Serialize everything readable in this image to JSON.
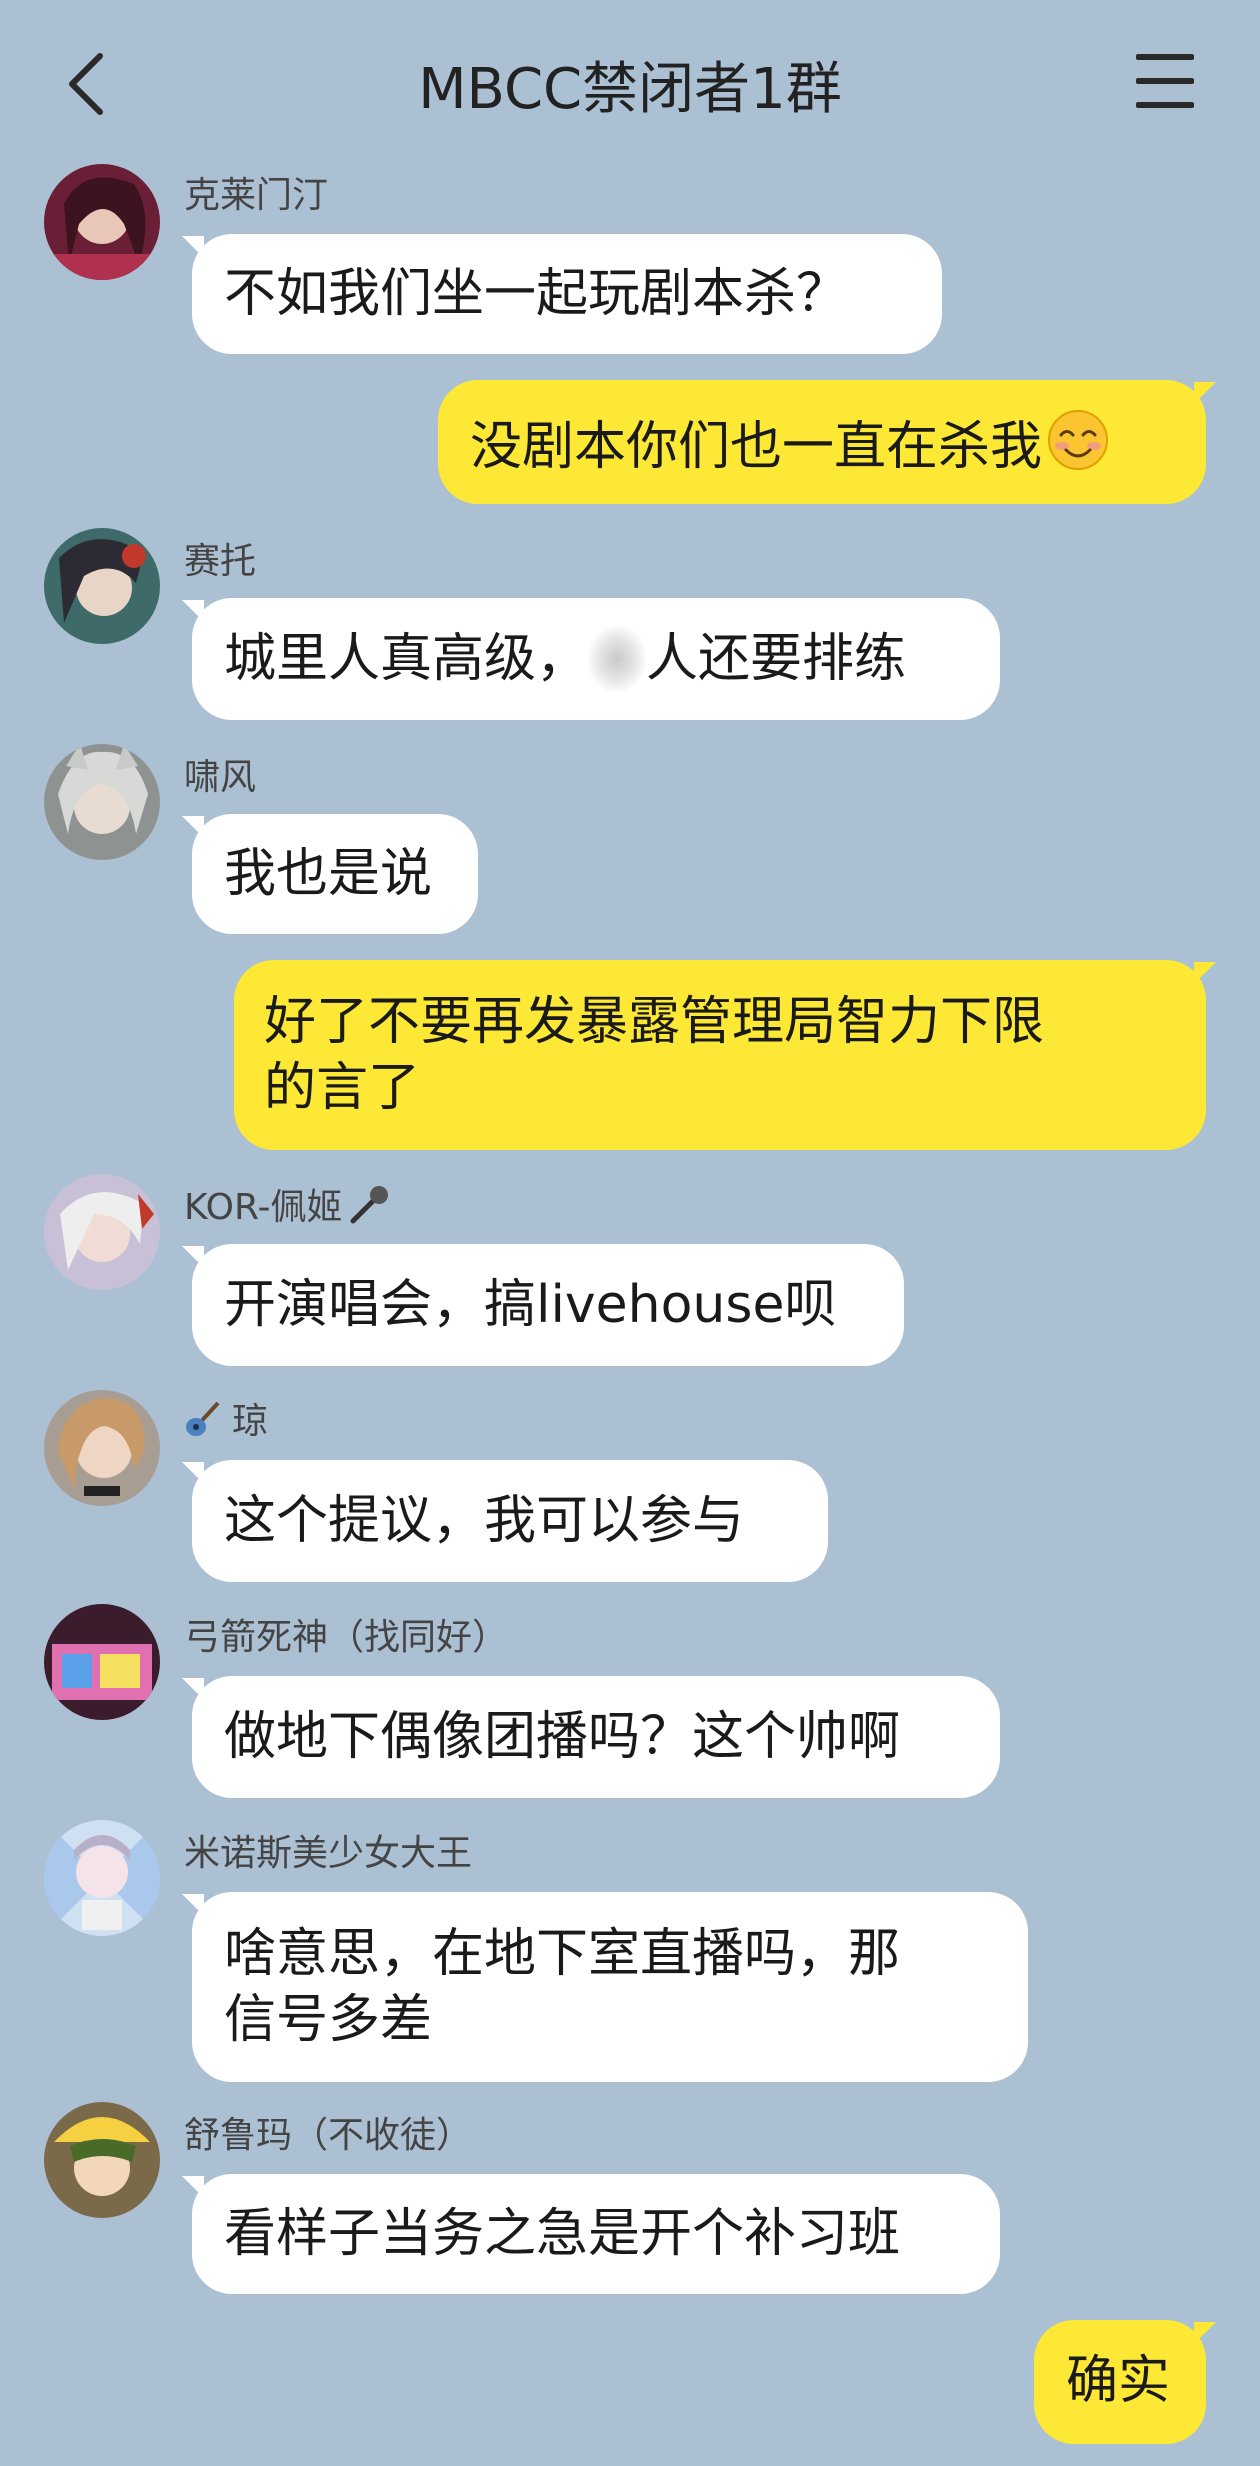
{
  "header": {
    "title": "MBCC禁闭者1群",
    "back_icon": "chevron-left-icon",
    "menu_icon": "hamburger-menu-icon"
  },
  "colors": {
    "background": "#abc0d3",
    "incoming_bubble": "#ffffff",
    "outgoing_bubble": "#fde935"
  },
  "messages": [
    {
      "sender": "克莱门汀",
      "text": "不如我们坐一起玩剧本杀？"
    },
    {
      "text": "没剧本你们也一直在杀我",
      "emoji": "smiling-face-icon"
    },
    {
      "sender": "赛托",
      "text_before": "城里人真高级，",
      "text_after": "人还要排练"
    },
    {
      "sender": "啸风",
      "text": "我也是说"
    },
    {
      "lines": [
        "好了不要再发暴露管理局智力下限",
        "的言了"
      ]
    },
    {
      "sender": "KOR-佩姬",
      "sender_icon": "microphone-icon",
      "text": "开演唱会，搞livehouse呗"
    },
    {
      "sender": "琼",
      "sender_icon": "guitar-icon",
      "text": "这个提议，我可以参与"
    },
    {
      "sender": "弓箭死神（找同好）",
      "text": "做地下偶像团播吗？这个帅啊"
    },
    {
      "sender": "米诺斯美少女大王",
      "lines": [
        "啥意思，在地下室直播吗，那",
        "信号多差"
      ]
    },
    {
      "sender": "舒鲁玛（不收徒）",
      "text": "看样子当务之急是开个补习班"
    },
    {
      "text": "确实"
    }
  ]
}
